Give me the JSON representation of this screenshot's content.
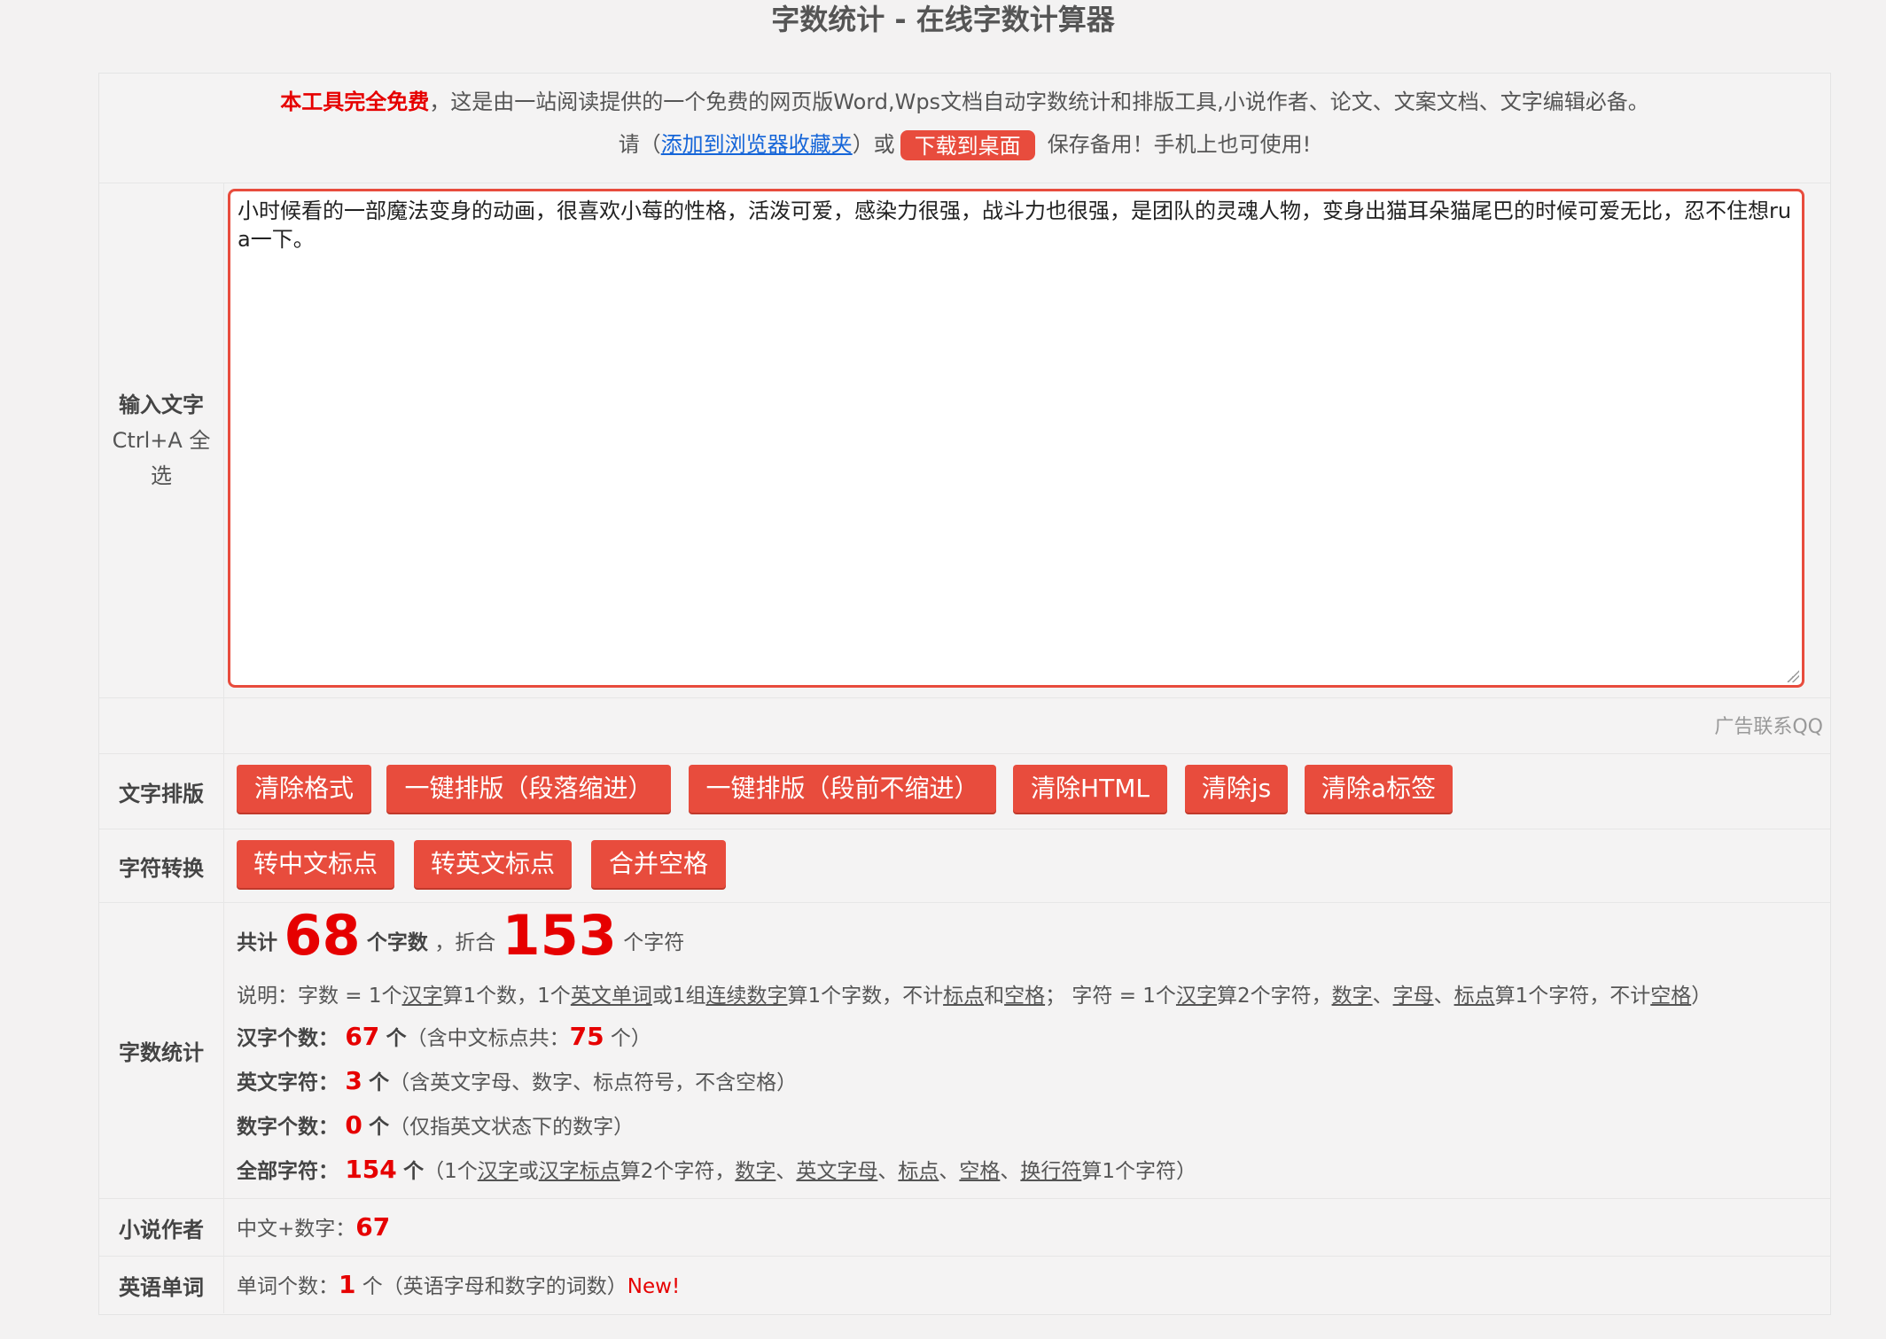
{
  "header": {
    "title": "字数统计 - 在线字数计算器"
  },
  "notice": {
    "free_label": "本工具完全免费",
    "line1_rest": "，这是由一站阅读提供的一个免费的网页版Word,Wps文档自动字数统计和排版工具,小说作者、论文、文案文档、文字编辑必备。",
    "line2_prefix": "请（",
    "bookmark_link": "添加到浏览器收藏夹",
    "line2_or": "）或",
    "download_button": "下载到桌面",
    "line2_suffix": "保存备用！手机上也可使用!"
  },
  "input": {
    "label": "输入文字",
    "sublabel1": "Ctrl+A 全",
    "sublabel2": "选",
    "text": "小时候看的一部魔法变身的动画，很喜欢小莓的性格，活泼可爱，感染力很强，战斗力也很强，是团队的灵魂人物，变身出猫耳朵猫尾巴的时候可爱无比，忍不住想rua一下。"
  },
  "ad": {
    "text": "广告联系QQ"
  },
  "format": {
    "label": "文字排版",
    "buttons": [
      "清除格式",
      "一键排版（段落缩进）",
      "一键排版（段前不缩进）",
      "清除HTML",
      "清除js",
      "清除a标签"
    ]
  },
  "convert": {
    "label": "字符转换",
    "buttons": [
      "转中文标点",
      "转英文标点",
      "合并空格"
    ]
  },
  "stats": {
    "label": "字数统计",
    "total_prefix": "共计",
    "word_count": "68",
    "word_unit": "个字数",
    "sep": "，折合",
    "char_count": "153",
    "char_unit": "个字符",
    "note": {
      "p1": "说明：字数 = 1个",
      "u1": "汉字",
      "p2": "算1个数，1个",
      "u2": "英文单词",
      "p3": "或1组",
      "u3": "连续数字",
      "p4": "算1个字数，不计",
      "u4": "标点",
      "p5": "和",
      "u5": "空格",
      "p6": "；  字符 = 1个",
      "u6": "汉字",
      "p7": "算2个字符，",
      "u7": "数字",
      "p8": "、",
      "u8": "字母",
      "p9": "、",
      "u9": "标点",
      "p10": "算1个字符，不计",
      "u10": "空格",
      "p11": "）"
    },
    "hanzi": {
      "label": "汉字个数：",
      "value": "67",
      "unit": "个",
      "desc_prefix": "（含中文标点共：",
      "punct": "75",
      "desc_suffix": " 个）"
    },
    "english": {
      "label": "英文字符：",
      "value": "3",
      "unit": "个",
      "desc": "（含英文字母、数字、标点符号，不含空格）"
    },
    "digits": {
      "label": "数字个数：",
      "value": "0",
      "unit": "个",
      "desc": "（仅指英文状态下的数字）"
    },
    "all": {
      "label": "全部字符：",
      "value": "154",
      "unit": "个",
      "d1": "（1个",
      "u1": "汉字",
      "d2": "或",
      "u2": "汉字标点",
      "d3": "算2个字符，",
      "u3": "数字",
      "d4": "、",
      "u4": "英文字母",
      "d5": "、",
      "u5": "标点",
      "d6": "、",
      "u6": "空格",
      "d7": "、",
      "u7": "换行符",
      "d8": "算1个字符）"
    }
  },
  "novel": {
    "label": "小说作者",
    "text": "中文+数字：",
    "value": "67"
  },
  "english_words": {
    "label": "英语单词",
    "text": "单词个数：",
    "value": "1",
    "unit": "个",
    "desc": "（英语字母和数字的词数）",
    "new": "New!"
  }
}
